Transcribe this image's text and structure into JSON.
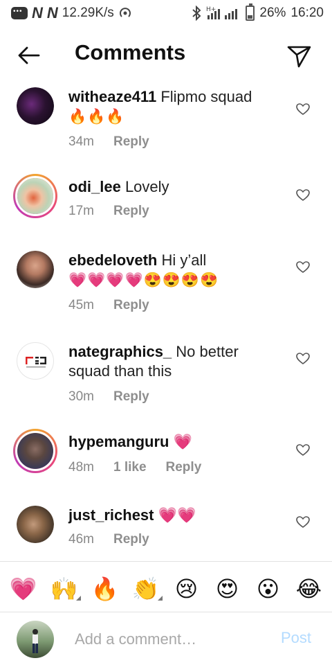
{
  "status_bar": {
    "net_speed": "12.29K/s",
    "net_type": "H+",
    "battery": "26%",
    "battery_level": 0.26,
    "time": "16:20"
  },
  "header": {
    "title": "Comments"
  },
  "comments": [
    {
      "username": "witheaze411",
      "text": "Flipmo squad",
      "emojis": "🔥🔥🔥",
      "time": "34m",
      "likes": "",
      "reply": "Reply"
    },
    {
      "username": "odi_lee",
      "text": "Lovely",
      "emojis": "",
      "time": "17m",
      "likes": "",
      "reply": "Reply"
    },
    {
      "username": "ebedeloveth",
      "text": "Hi y’all",
      "emojis": "💗💗💗💗😍😍😍😍",
      "time": "45m",
      "likes": "",
      "reply": "Reply"
    },
    {
      "username": "nategraphics_",
      "text": "No better squad than this",
      "emojis": "",
      "time": "30m",
      "likes": "",
      "reply": "Reply"
    },
    {
      "username": "hypemanguru",
      "text": "💗",
      "emojis": "",
      "time": "48m",
      "likes": "1 like",
      "reply": "Reply"
    },
    {
      "username": "just_richest",
      "text": "💗💗",
      "emojis": "",
      "time": "46m",
      "likes": "",
      "reply": "Reply"
    }
  ],
  "quick_emojis": [
    "💗",
    "🙌",
    "🔥",
    "👏",
    "😢",
    "😍",
    "😮",
    "😂"
  ],
  "composer": {
    "placeholder": "Add a comment…",
    "post_label": "Post"
  },
  "colors": {
    "accent_post_disabled": "#b3dbff",
    "meta_gray": "#8e8e8e",
    "story_ring": "#e9487a"
  }
}
